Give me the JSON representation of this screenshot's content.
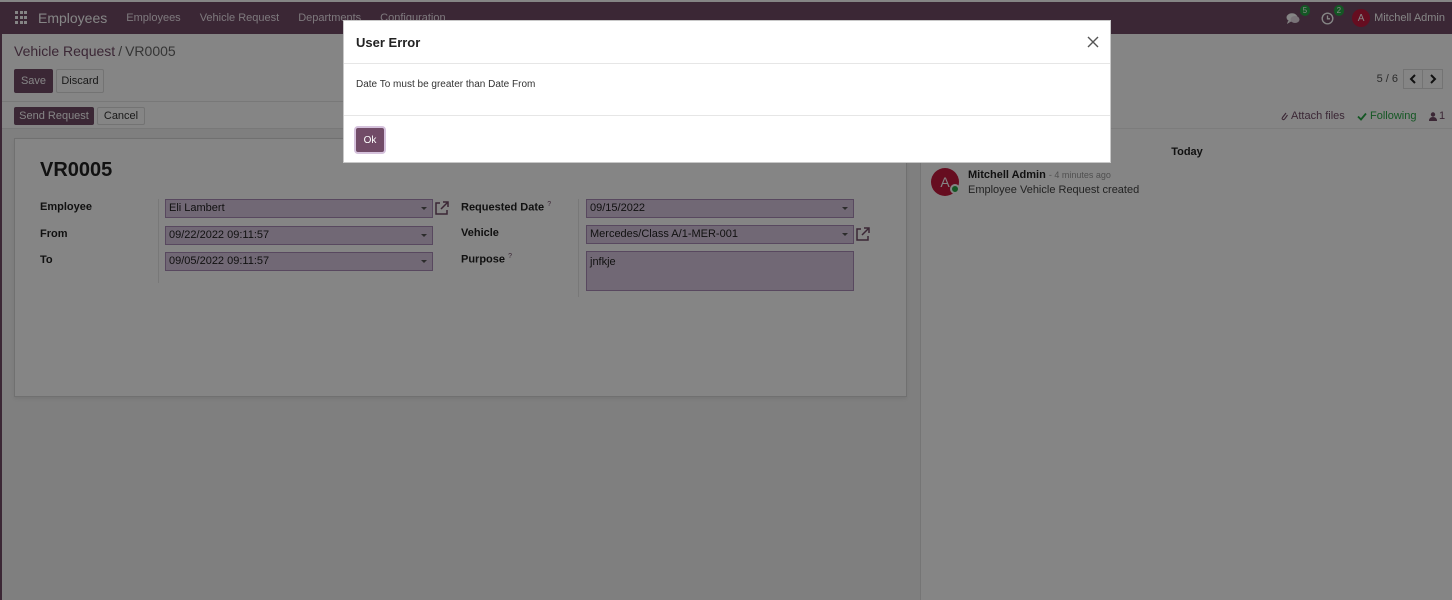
{
  "navbar": {
    "app_name": "Employees",
    "menu": [
      "Employees",
      "Vehicle Request",
      "Departments",
      "Configuration"
    ],
    "messages_count": "5",
    "activities_count": "2",
    "user_initial": "A",
    "user_name": "Mitchell Admin"
  },
  "control_panel": {
    "breadcrumb_parent": "Vehicle Request",
    "breadcrumb_separator": "/",
    "breadcrumb_current": "VR0005",
    "save_label": "Save",
    "discard_label": "Discard",
    "pager": "5 / 6"
  },
  "statusbar": {
    "send_request_label": "Send Request",
    "cancel_label": "Cancel"
  },
  "form": {
    "title": "VR0005",
    "employee_label": "Employee",
    "employee_value": "Eli Lambert",
    "from_label": "From",
    "from_value": "09/22/2022 09:11:57",
    "to_label": "To",
    "to_value": "09/05/2022 09:11:57",
    "requested_date_label": "Requested Date",
    "requested_date_value": "09/15/2022",
    "vehicle_label": "Vehicle",
    "vehicle_value": "Mercedes/Class A/1-MER-001",
    "purpose_label": "Purpose",
    "purpose_value": "jnfkje",
    "help_mark": "?"
  },
  "chatter": {
    "attach_label": "Attach files",
    "following_label": "Following",
    "followers_count": "1",
    "date_separator": "Today",
    "message_author": "Mitchell Admin",
    "message_time": "- 4 minutes ago",
    "message_body": "Employee Vehicle Request created",
    "author_initial": "A"
  },
  "modal": {
    "title": "User Error",
    "body": "Date To must be greater than Date From",
    "ok_label": "Ok"
  },
  "colors": {
    "primary": "#714b67",
    "success": "#28a745",
    "avatar": "#c3193e"
  }
}
